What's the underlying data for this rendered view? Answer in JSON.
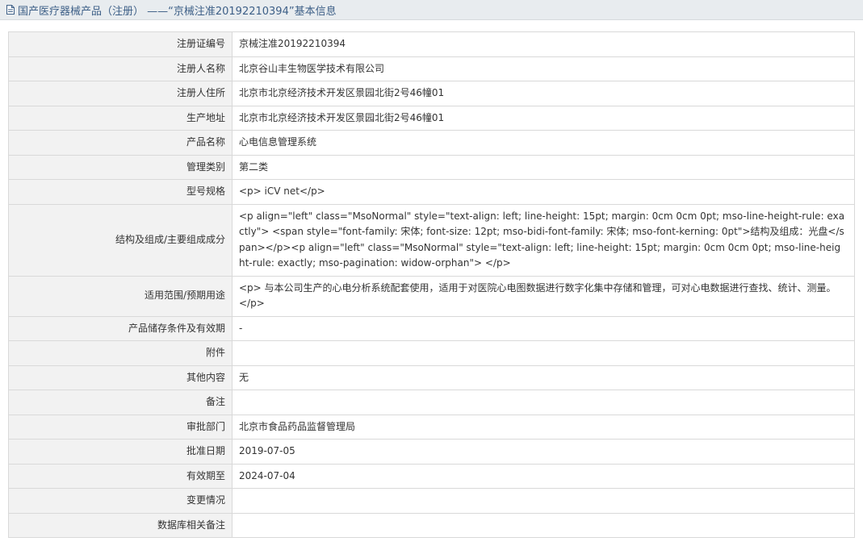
{
  "header": {
    "title": "国产医疗器械产品（注册） ——“京械注准20192210394”基本信息"
  },
  "rows": [
    {
      "label": "注册证编号",
      "value": "京械注准20192210394"
    },
    {
      "label": "注册人名称",
      "value": "北京谷山丰生物医学技术有限公司"
    },
    {
      "label": "注册人住所",
      "value": "北京市北京经济技术开发区景园北街2号46幢01"
    },
    {
      "label": "生产地址",
      "value": "北京市北京经济技术开发区景园北街2号46幢01"
    },
    {
      "label": "产品名称",
      "value": "心电信息管理系统"
    },
    {
      "label": "管理类别",
      "value": "第二类"
    },
    {
      "label": "型号规格",
      "value": "<p> iCV net</p>"
    },
    {
      "label": "结构及组成/主要组成成分",
      "value": "<p align=\"left\" class=\"MsoNormal\" style=\"text-align: left; line-height: 15pt; margin: 0cm 0cm 0pt; mso-line-height-rule: exactly\"> <span style=\"font-family: 宋体; font-size: 12pt; mso-bidi-font-family: 宋体; mso-font-kerning: 0pt\">结构及组成：光盘</span></p><p align=\"left\" class=\"MsoNormal\" style=\"text-align: left; line-height: 15pt; margin: 0cm 0cm 0pt; mso-line-height-rule: exactly; mso-pagination: widow-orphan\"> </p>"
    },
    {
      "label": "适用范围/预期用途",
      "value": "<p> 与本公司生产的心电分析系统配套使用，适用于对医院心电图数据进行数字化集中存储和管理，可对心电数据进行查找、统计、测量。</p>"
    },
    {
      "label": "产品储存条件及有效期",
      "value": "-"
    },
    {
      "label": "附件",
      "value": ""
    },
    {
      "label": "其他内容",
      "value": "无"
    },
    {
      "label": "备注",
      "value": ""
    },
    {
      "label": "审批部门",
      "value": "北京市食品药品监督管理局"
    },
    {
      "label": "批准日期",
      "value": "2019-07-05"
    },
    {
      "label": "有效期至",
      "value": "2024-07-04"
    },
    {
      "label": "变更情况",
      "value": ""
    },
    {
      "label": "数据库相关备注",
      "value": ""
    }
  ],
  "colors": {
    "title_text": "#3d5f87",
    "title_bg": "#e8ecef",
    "label_bg": "#f2f2f2",
    "border": "#d9d9d9"
  }
}
